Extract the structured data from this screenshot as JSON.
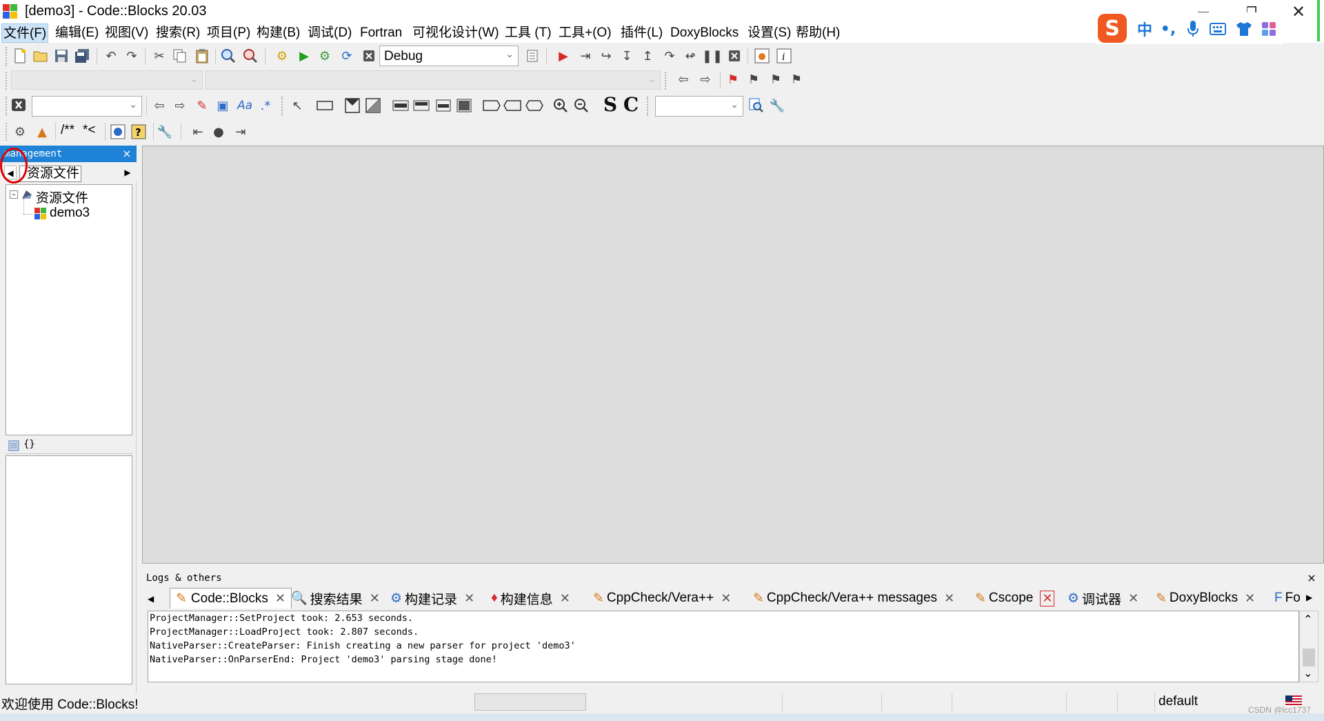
{
  "window": {
    "title": "[demo3] - Code::Blocks 20.03",
    "minimize_icon": "minimize-icon",
    "restore_icon": "restore-icon",
    "close_icon": "close-icon"
  },
  "menu": [
    "文件(F)",
    "编辑(E)",
    "视图(V)",
    "搜索(R)",
    "项目(P)",
    "构建(B)",
    "调试(D)",
    "Fortran",
    "可视化设计(W)",
    "工具 (T)",
    "工具+(O)",
    "插件(L)",
    "DoxyBlocks",
    "设置(S)",
    "帮助(H)"
  ],
  "ime": {
    "logo": "S",
    "mode": "中",
    "punct": "•,",
    "icons": [
      "mic-icon",
      "keyboard-icon",
      "skin-icon",
      "apps-icon"
    ]
  },
  "toolbar": {
    "build_target": "Debug",
    "comment_block": "/**",
    "comment_line": "*<",
    "search_S": "S",
    "search_C": "C"
  },
  "management": {
    "header": "management",
    "close": "×",
    "tab_label": "资源文件",
    "tree": {
      "root": "资源文件",
      "project": "demo3"
    },
    "symbols_label": "{}"
  },
  "logs": {
    "header": "Logs & others",
    "close": "×",
    "tabs": [
      "Code::Blocks",
      "搜索结果",
      "构建记录",
      "构建信息",
      "CppCheck/Vera++",
      "CppCheck/Vera++ messages",
      "Cscope",
      "调试器",
      "DoxyBlocks",
      "Fo"
    ],
    "lines": [
      "ProjectManager::SetProject took: 2.653 seconds.",
      "ProjectManager::LoadProject took: 2.807 seconds.",
      "NativeParser::CreateParser: Finish creating a new parser for project 'demo3'",
      "NativeParser::OnParserEnd: Project 'demo3' parsing stage done!"
    ]
  },
  "status": {
    "message": "欢迎使用 Code::Blocks!",
    "profile": "default",
    "watermark": "CSDN @lcc1737"
  },
  "colors": {
    "accent": "#1e82d7",
    "editor_bg": "#dcdcdc",
    "menu_active": "#cce4f7",
    "highlight_circle": "#e00000"
  }
}
